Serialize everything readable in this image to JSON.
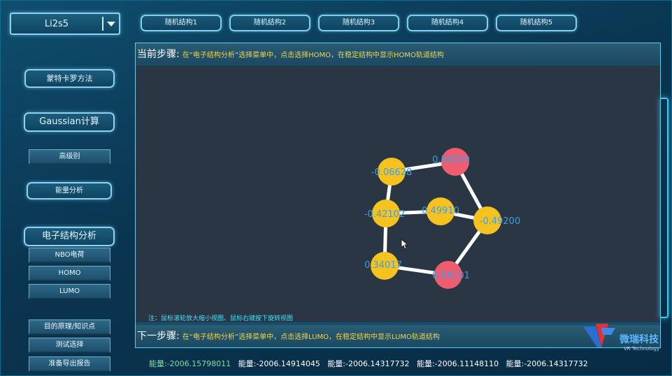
{
  "molecule_select": {
    "value": "Li2s5"
  },
  "tabs": [
    "随机结构1",
    "随机结构2",
    "随机结构3",
    "随机结构4",
    "随机结构5"
  ],
  "sidebar": {
    "monte_carlo": "蒙特卡罗方法",
    "gaussian": "Gaussian计算",
    "advanced": "高级别",
    "energy_analysis": "能量分析",
    "electronic": "电子结构分析",
    "nbo": "NBO电荷",
    "homo": "HOMO",
    "lumo": "LUMO",
    "principles": "目的原理/知识点",
    "test_select": "测试选择",
    "export_report": "准备导出报告"
  },
  "current_step": {
    "label": "当前步骤:",
    "text": "在“电子结构分析”选择菜单中，点击选择HOMO，在稳定结构中显示HOMO轨道结构"
  },
  "next_step": {
    "label": "下一步骤:",
    "text": "在“电子结构分析”选择菜单中，点击选择LUMO，在稳定结构中显示LUMO轨道结构"
  },
  "note": "注：鼠标滚轮放大缩小视图、鼠标右键按下旋转视图",
  "atoms": [
    {
      "label": "-0.06628",
      "color": "#f6c21f"
    },
    {
      "label": "0.50899",
      "color": "#ef5b6f"
    },
    {
      "label": "-0.42102",
      "color": "#f6c21f"
    },
    {
      "label": "0.49910",
      "color": "#f6c21f"
    },
    {
      "label": "-0.49200",
      "color": "#f6c21f"
    },
    {
      "label": "0.34017",
      "color": "#f6c21f"
    },
    {
      "label": "0.54101",
      "color": "#ef5b6f"
    }
  ],
  "energies": [
    "能量:-2006.15798011",
    "能量:-2006.14914045",
    "能量:-2006.14317732",
    "能量:-2006.11148110",
    "能量:-2006.14317732"
  ],
  "brand": {
    "name": "微瑞科技",
    "sub": "VR Technology"
  },
  "colors": {
    "label_text": "#3aa0e8",
    "bond": "#ffffff",
    "energy_first": "#7fe0a0"
  }
}
